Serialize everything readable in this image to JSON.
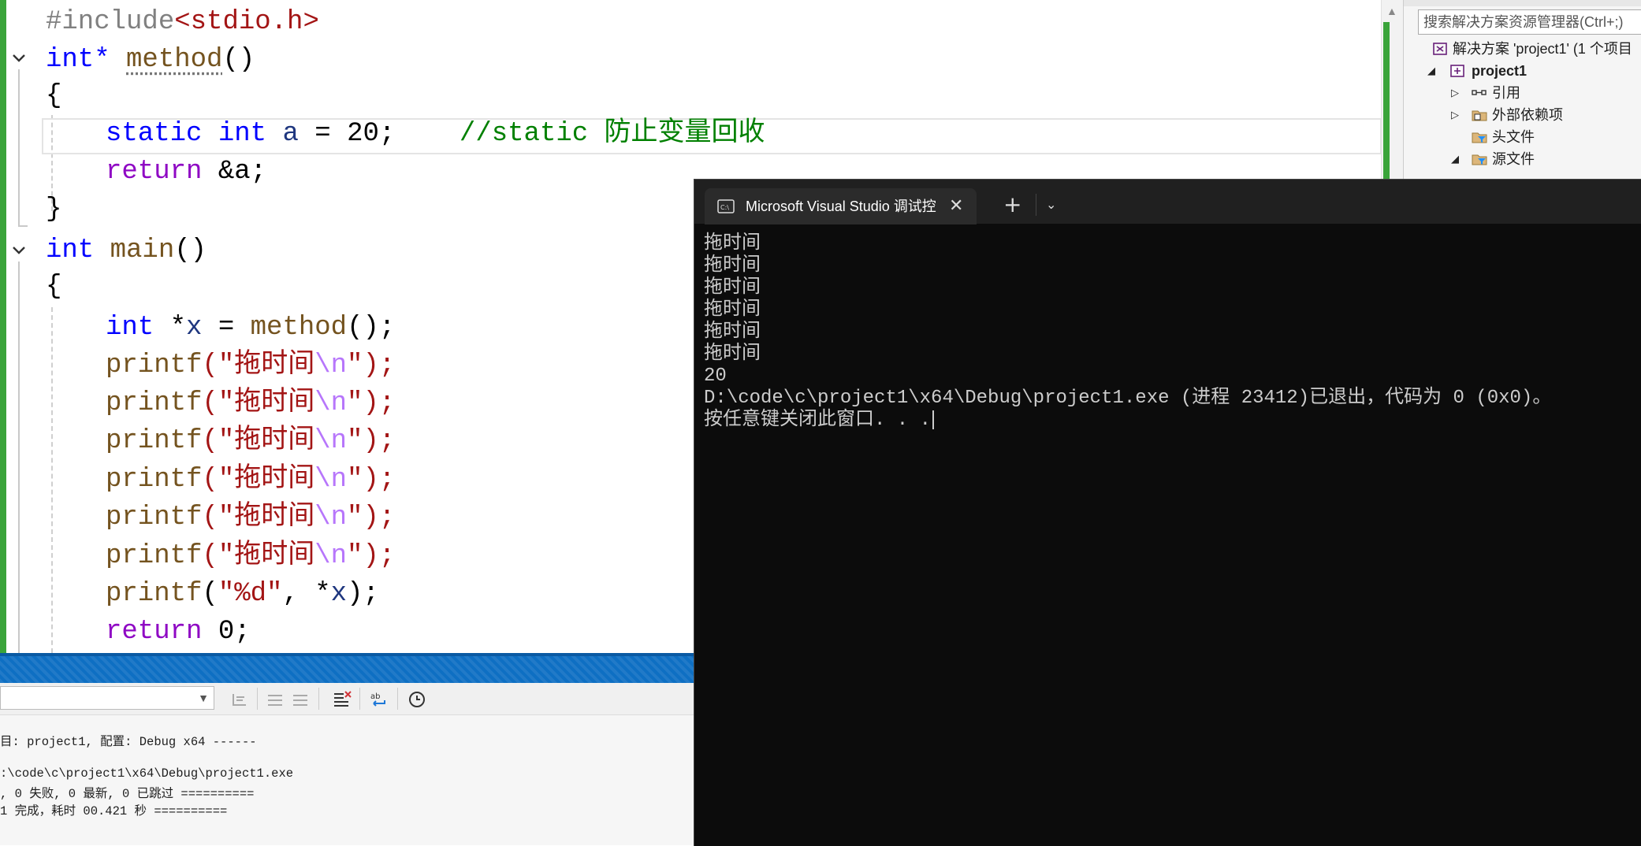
{
  "editor": {
    "include_directive": "#include",
    "include_header": "<stdio.h>",
    "method_return_type": "int*",
    "method_name": "method",
    "method_parens": "()",
    "open_brace": "{",
    "close_brace": "}",
    "static_kw": "static",
    "int_kw": "int",
    "var_a": "a",
    "assign": " = ",
    "value_20": "20",
    "semicolon": ";",
    "comment": "//static 防止变量回收",
    "return_kw": "return",
    "addr_a": " &a;",
    "main_type": "int",
    "main_name": "main",
    "x_decl_star": " *",
    "var_x": "x",
    "x_assign": " = ",
    "method_call": "method",
    "call_end": "();",
    "printf": "printf",
    "open_paren_quote": "(\"",
    "print_text": "拖时间",
    "escape_n": "\\n",
    "close_quote_paren": "\");",
    "fmt_d": "\"%d\"",
    "comma_deref": ", *",
    "close_paren_semi": ");",
    "return_zero_val": "0",
    "printf_count_label": "6"
  },
  "solution_explorer": {
    "search_placeholder": "搜索解决方案资源管理器(Ctrl+;)",
    "solution_label": "解决方案 'project1' (1 个项目",
    "project_label": "project1",
    "references_label": "引用",
    "external_deps_label": "外部依赖项",
    "header_files_label": "头文件",
    "source_files_label": "源文件"
  },
  "output": {
    "lines": [
      "目: project1, 配置: Debug x64 ------",
      "",
      ":\\code\\c\\project1\\x64\\Debug\\project1.exe",
      ", 0 失败, 0 最新, 0 已跳过 ==========",
      "1 完成，耗时 00.421 秒 =========="
    ]
  },
  "console": {
    "tab_title": "Microsoft Visual Studio 调试控",
    "lines": [
      "拖时间",
      "拖时间",
      "拖时间",
      "拖时间",
      "拖时间",
      "拖时间",
      "20",
      "D:\\code\\c\\project1\\x64\\Debug\\project1.exe (进程 23412)已退出，代码为 0 (0x0)。",
      "按任意键关闭此窗口. . ."
    ]
  },
  "colors": {
    "keyword": "#0000ff",
    "control_keyword": "#8f08c4",
    "function": "#74531f",
    "string": "#a31515",
    "escape": "#b776fb",
    "comment": "#008000",
    "change_bar": "#3aa43a",
    "status_blue": "#0e6fc3",
    "console_bg": "#0c0c0c"
  }
}
